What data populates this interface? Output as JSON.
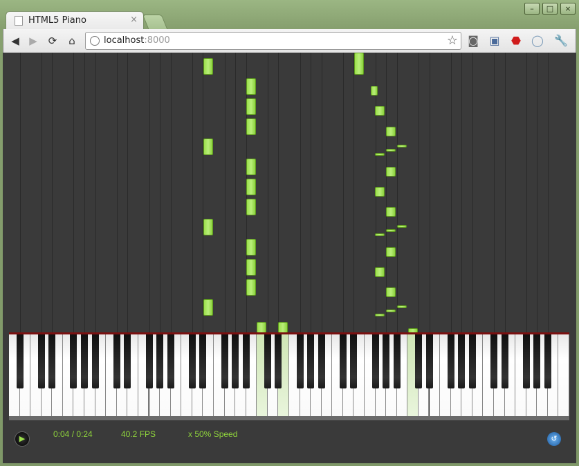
{
  "browser": {
    "tab_title": "HTML5 Piano",
    "tab_close": "×",
    "url_host": "localhost",
    "url_port": ":8000",
    "window_controls": [
      "–",
      "□",
      "×"
    ],
    "nav_icons": [
      "back-icon",
      "forward-icon",
      "reload-icon",
      "home-icon"
    ]
  },
  "player": {
    "time": "0:04 / 0:24",
    "fps": "40.2 FPS",
    "speed": "x 50% Speed"
  },
  "colors": {
    "note": "#9be04b",
    "background": "#3a3a3a",
    "status_text": "#8fd43c"
  }
}
